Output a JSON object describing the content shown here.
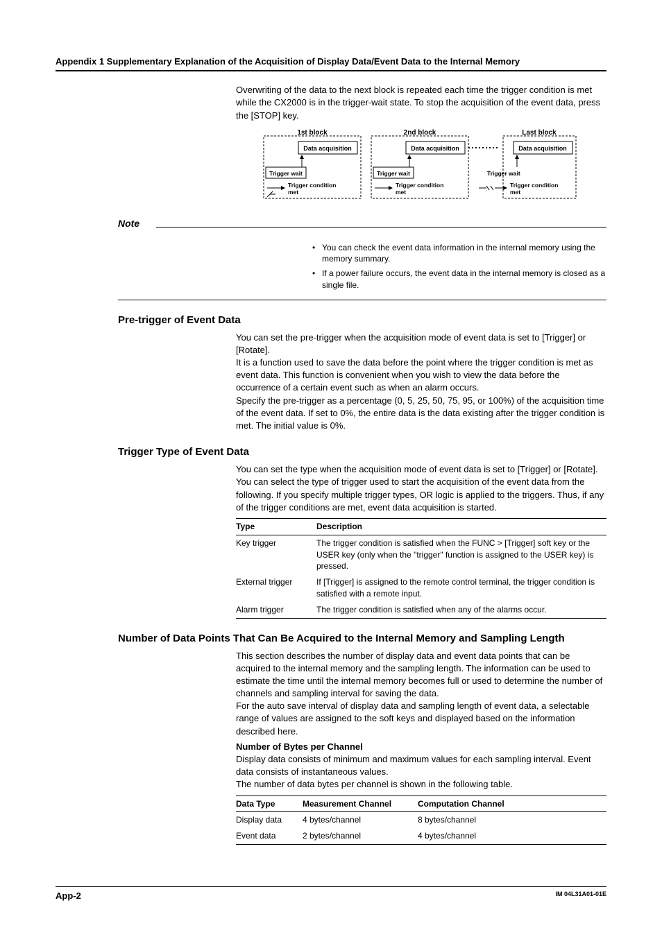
{
  "header": "Appendix 1  Supplementary Explanation of the Acquisition of Display Data/Event Data to the Internal Memory",
  "intro": "Overwriting of the data to the next block is repeated each time the trigger condition is met while the CX2000 is in the trigger-wait state.  To stop the acquisition of the event data, press the [STOP] key.",
  "diagram": {
    "block1": "1st block",
    "block2": "2nd block",
    "blocklast": "Last block",
    "acq": "Data acquisition",
    "wait": "Trigger wait",
    "cond": "Trigger condition met"
  },
  "note_label": "Note",
  "notes": [
    "You can check the event data information in the internal memory using the memory summary.",
    "If a power failure occurs, the event data in the internal memory is closed as a single file."
  ],
  "sec1": {
    "title": "Pre-trigger of Event Data",
    "p1": "You can set the pre-trigger when the acquisition mode of event data is set to [Trigger] or [Rotate].",
    "p2": "It is a function used to save the data before the point where the trigger condition is met as event data.  This function is convenient when you wish to view the data before the occurrence of a certain event such as when an alarm occurs.",
    "p3": "Specify the pre-trigger as a percentage (0, 5, 25, 50, 75, 95, or 100%) of the acquisition time of the event data.  If set to 0%, the entire data is the data existing after the trigger condition is met.  The initial value is 0%."
  },
  "sec2": {
    "title": "Trigger Type of Event Data",
    "p1": "You can set the type when the acquisition mode of event data is set to [Trigger] or [Rotate]. You can select the type of trigger used to start the acquisition of the event data from the following.  If you specify multiple trigger types, OR logic is applied to the triggers.  Thus, if any of the trigger conditions are met, event data acquisition is started.",
    "table": {
      "h1": "Type",
      "h2": "Description",
      "rows": [
        {
          "c1": "Key trigger",
          "c2": "The trigger condition is satisfied when the FUNC > [Trigger] soft key or the USER key (only when the \"trigger\" function is assigned to the USER key) is pressed."
        },
        {
          "c1": "External trigger",
          "c2": "If [Trigger] is assigned to the remote control terminal, the trigger condition is satisfied with a remote input."
        },
        {
          "c1": "Alarm trigger",
          "c2": "The trigger condition is satisfied when any of the alarms occur."
        }
      ]
    }
  },
  "sec3": {
    "title": "Number of Data Points That Can Be Acquired to the Internal Memory and Sampling Length",
    "p1": "This section describes the number of display data and event data points that can be acquired to the internal memory and the sampling length.  The information can be used to estimate the time until the internal memory becomes full or used to determine the number of channels and sampling interval for saving the data.",
    "p2": "For the auto save interval of display data and sampling length of event data, a selectable range of values are assigned to the soft keys and displayed based on the information described here.",
    "sub": "Number of Bytes per Channel",
    "p3": "Display data consists of minimum and maximum values for each sampling interval. Event data consists of instantaneous values.",
    "p4": "The number of data bytes per channel is shown in the following table.",
    "table": {
      "h1": "Data Type",
      "h2": "Measurement Channel",
      "h3": "Computation Channel",
      "rows": [
        {
          "c1": "Display data",
          "c2": "4 bytes/channel",
          "c3": "8 bytes/channel"
        },
        {
          "c1": "Event data",
          "c2": "2 bytes/channel",
          "c3": "4 bytes/channel"
        }
      ]
    }
  },
  "footer": {
    "page": "App-2",
    "doc": "IM 04L31A01-01E"
  }
}
